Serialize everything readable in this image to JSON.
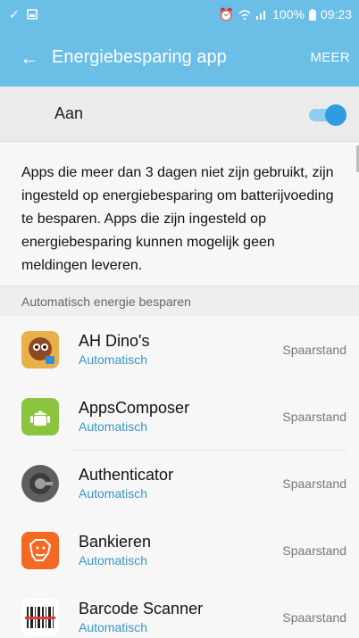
{
  "status": {
    "battery": "100%",
    "time": "09:23"
  },
  "appbar": {
    "title": "Energiebesparing app",
    "more": "MEER"
  },
  "toggle": {
    "label": "Aan",
    "on": true
  },
  "description": "Apps die meer dan 3 dagen niet zijn gebruikt, zijn ingesteld op energiebesparing om batterijvoeding te besparen. Apps die zijn ingesteld op energiebesparing kunnen mogelijk geen meldingen leveren.",
  "section_title": "Automatisch energie besparen",
  "apps": [
    {
      "name": "AH Dino's",
      "sub": "Automatisch",
      "mode": "Spaarstand",
      "icon": "ah-dinos-icon"
    },
    {
      "name": "AppsComposer",
      "sub": "Automatisch",
      "mode": "Spaarstand",
      "icon": "android-icon"
    },
    {
      "name": "Authenticator",
      "sub": "Automatisch",
      "mode": "Spaarstand",
      "icon": "authenticator-icon"
    },
    {
      "name": "Bankieren",
      "sub": "Automatisch",
      "mode": "Spaarstand",
      "icon": "ing-lion-icon"
    },
    {
      "name": "Barcode Scanner",
      "sub": "Automatisch",
      "mode": "Spaarstand",
      "icon": "barcode-icon"
    }
  ],
  "colors": {
    "accent": "#6bbee6",
    "link": "#3a95c9",
    "switch": "#2f9be0"
  }
}
